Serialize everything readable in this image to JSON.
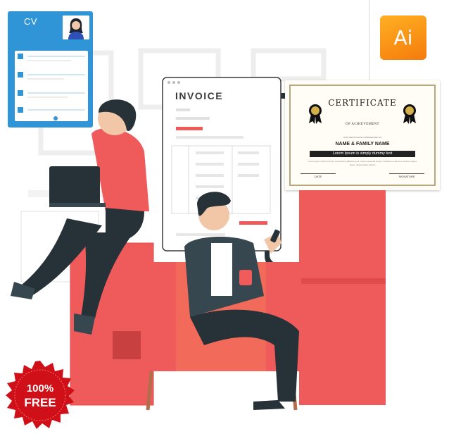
{
  "cv": {
    "title": "CV",
    "icon": "person-photo-icon"
  },
  "invoice": {
    "title": "INVOICE"
  },
  "ai_logo": {
    "label": "Ai"
  },
  "certificate": {
    "title": "CERTIFICATE",
    "subtitle": "OF ACHIEVEMENT",
    "presented": "THIS CERTIFICATE IS PRESENTED TO",
    "name": "NAME & FAMILY NAME",
    "band": "Lorem Ipsum is simply dummy text",
    "body": "Lorem ipsum dolor sit amet, consectetur adipiscing elit, sed do eiusmod tempor incididunt ut labore et dolore magna aliqua. Suspendisse dictum",
    "date_label": "DATE",
    "signature_label": "SIGNATURE"
  },
  "badge": {
    "percent": "100%",
    "word": "FREE"
  },
  "colors": {
    "accent_red": "#ef5a5a",
    "cv_blue": "#2f95d6",
    "ai_orange": "#f57b0c",
    "badge_red": "#d01018",
    "dark": "#263238"
  }
}
